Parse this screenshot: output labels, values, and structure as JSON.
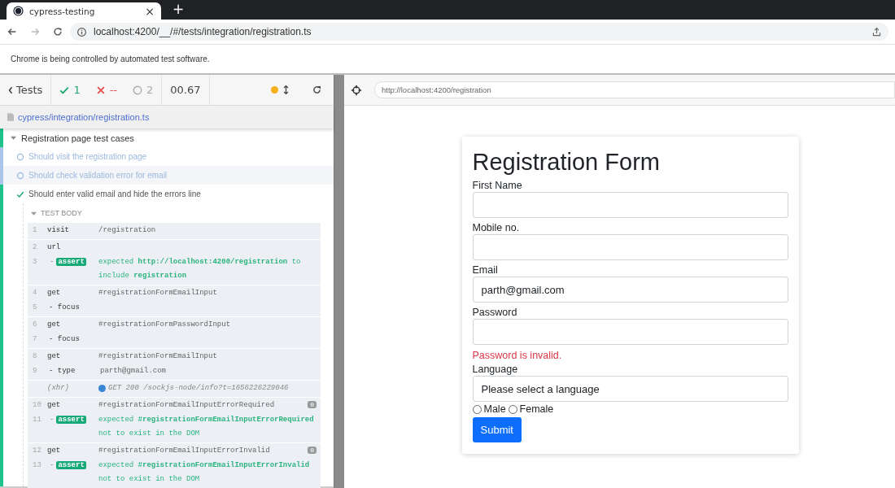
{
  "browser": {
    "tab_title": "cypress-testing",
    "tab_close": "×",
    "new_tab": "+",
    "url": "localhost:4200/__/#/tests/integration/registration.ts",
    "infobar": "Chrome is being controlled by automated test software."
  },
  "runner": {
    "back": "Tests",
    "passed": "1",
    "failed": "--",
    "pending": "2",
    "duration": "00.67",
    "file": "cypress/integration/registration.ts",
    "suite": "Registration page test cases",
    "tests": [
      {
        "title": "Should visit the registration page",
        "kind": "pending",
        "selected": false
      },
      {
        "title": "Should check validation error for email",
        "kind": "pending",
        "selected": true
      },
      {
        "title": "Should enter valid email and hide the errors line",
        "kind": "passed",
        "selected": false
      }
    ],
    "test_body": "TEST BODY",
    "groups": [
      [
        {
          "kind": "command",
          "num": "1",
          "name": "visit",
          "message": "/registration"
        }
      ],
      [
        {
          "kind": "command",
          "num": "2",
          "name": "url"
        },
        {
          "kind": "assert",
          "num": "3",
          "prefix": "-",
          "name": "assert",
          "message": "expected **http://localhost:4200/registration** to include **registration**"
        }
      ],
      [
        {
          "kind": "command",
          "num": "4",
          "name": "get",
          "message": "#registrationFormEmailInput"
        },
        {
          "kind": "child",
          "num": "5",
          "name": "- focus"
        }
      ],
      [
        {
          "kind": "command",
          "num": "6",
          "name": "get",
          "message": "#registrationFormPasswordInput"
        },
        {
          "kind": "child",
          "num": "7",
          "name": "- focus"
        }
      ],
      [
        {
          "kind": "command",
          "num": "8",
          "name": "get",
          "message": "#registrationFormEmailInput"
        },
        {
          "kind": "child",
          "num": "9",
          "name": "- type",
          "message": "parth@gmail.com"
        }
      ],
      [
        {
          "kind": "xhr",
          "name": "(xhr)",
          "message": "GET 200 /sockjs-node/info?t=1656226229046"
        }
      ],
      [
        {
          "kind": "command",
          "num": "10",
          "name": "get",
          "message": "#registrationFormEmailInputErrorRequired",
          "badge": "0"
        },
        {
          "kind": "assert",
          "num": "11",
          "prefix": "-",
          "name": "assert",
          "message": "expected **#registrationFormEmailInputErrorRequired** not to exist in the DOM"
        }
      ],
      [
        {
          "kind": "command",
          "num": "12",
          "name": "get",
          "message": "#registrationFormEmailInputErrorInvalid",
          "badge": "0"
        },
        {
          "kind": "assert",
          "num": "13",
          "prefix": "-",
          "name": "assert",
          "message": "expected **#registrationFormEmailInputErrorInvalid** not to exist in the DOM"
        }
      ]
    ],
    "app_url": "http://localhost:4200/registration"
  },
  "form": {
    "title": "Registration Form",
    "fields": [
      {
        "label": "First Name"
      },
      {
        "label": "Mobile no."
      },
      {
        "label": "Email",
        "value": "parth@gmail.com"
      },
      {
        "label": "Password",
        "error": "Password is invalid."
      },
      {
        "label": "Language",
        "value": "Please select a language"
      }
    ],
    "radios": [
      {
        "label": "Male",
        "checked": false
      },
      {
        "label": "Female",
        "checked": false
      }
    ],
    "submit": "Submit"
  }
}
